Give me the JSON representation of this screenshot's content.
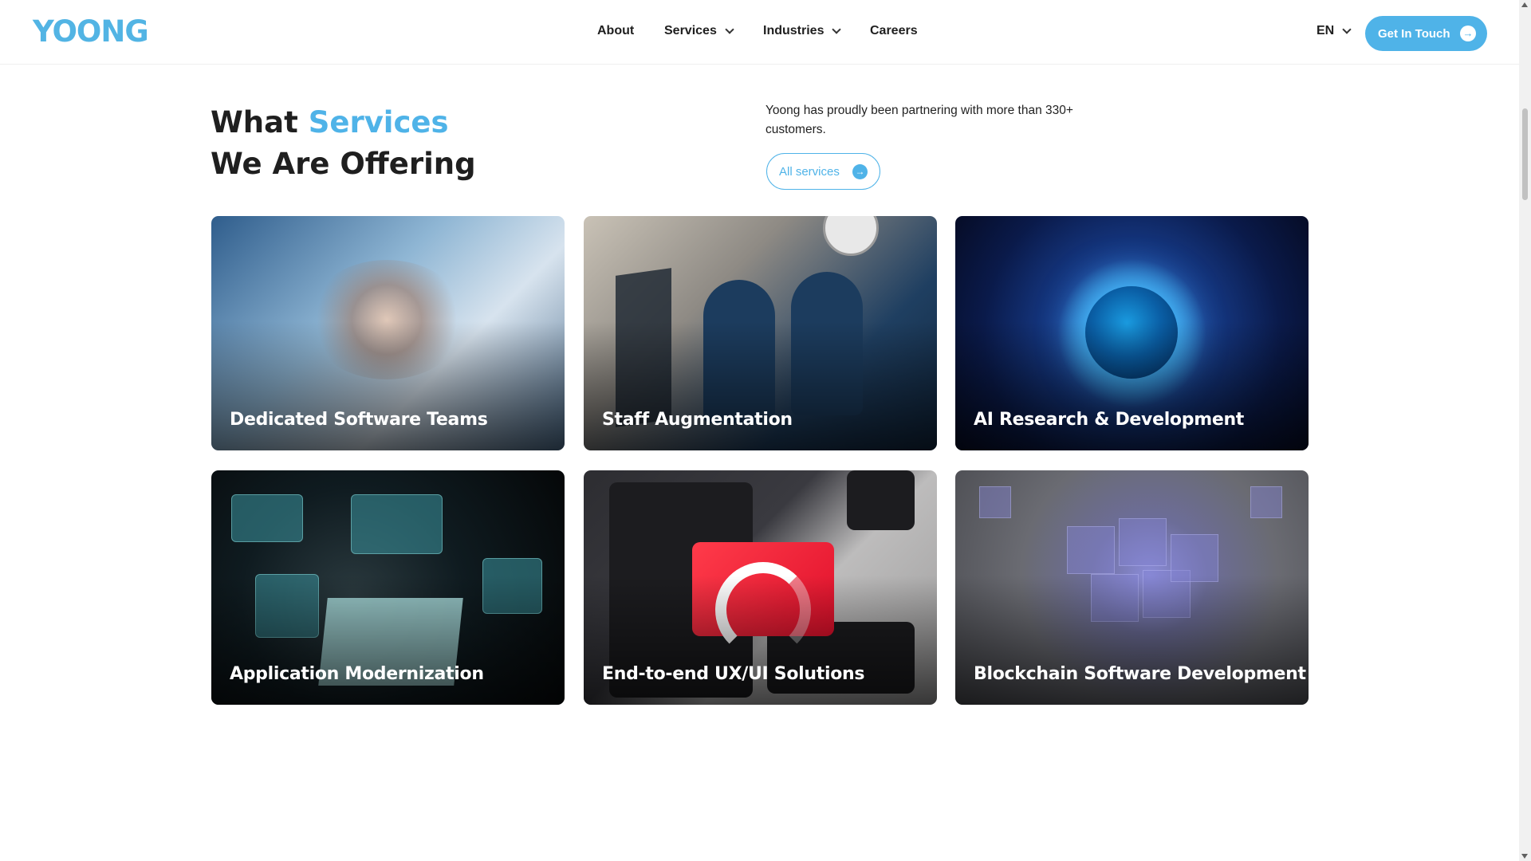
{
  "header": {
    "logo": "YOONG",
    "nav": {
      "about": "About",
      "services": "Services",
      "industries": "Industries",
      "careers": "Careers"
    },
    "language": "EN",
    "cta_label": "Get In Touch"
  },
  "section": {
    "title_part1": "What ",
    "title_accent": "Services",
    "title_line2": "We Are Offering",
    "intro": "Yoong has proudly been partnering with more than 330+ customers.",
    "all_services_label": "All services"
  },
  "cards": [
    {
      "title": "Dedicated Software Teams"
    },
    {
      "title": "Staff Augmentation"
    },
    {
      "title": "AI Research & Development"
    },
    {
      "title": "Application Modernization"
    },
    {
      "title": "End-to-end UX/UI Solutions"
    },
    {
      "title": "Blockchain Software Development"
    }
  ],
  "colors": {
    "accent": "#4fb3e8",
    "text": "#1f1f1f"
  }
}
